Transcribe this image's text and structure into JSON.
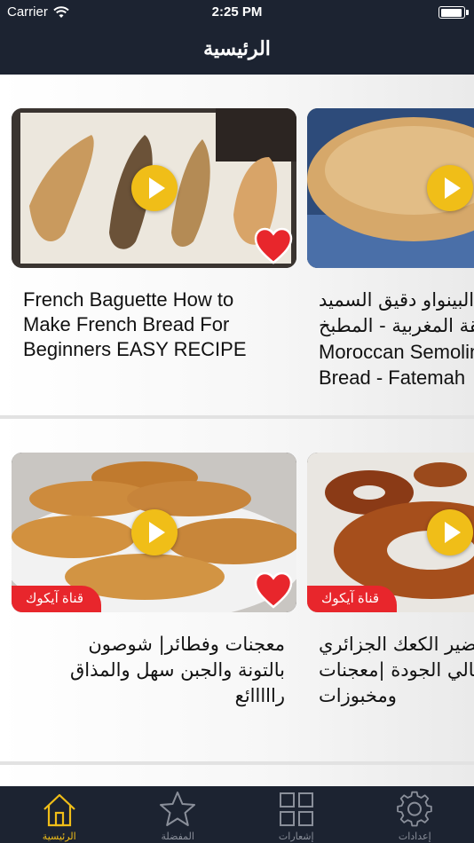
{
  "status_bar": {
    "carrier": "Carrier",
    "time": "2:25 PM",
    "battery_level": 0.95
  },
  "nav": {
    "title": "الرئيسية"
  },
  "rows": [
    {
      "cards": [
        {
          "title_lines": [
            "French Baguette How to",
            "Make French Bread For",
            "Beginners EASY RECIPE"
          ],
          "favorite": true,
          "badge": ""
        },
        {
          "title_lines": [
            "طريقة خبز البينواو دقيق السميد",
            "بالطريقة المغربية - المطبخ",
            "Moroccan Semolina",
            "Bread - Fatemah"
          ],
          "favorite": false,
          "badge": ""
        }
      ]
    },
    {
      "cards": [
        {
          "title_lines": [
            "معجنات وفطائر| شوصون",
            "بالتونة والجبن سهل والمذاق",
            "رااااائع"
          ],
          "favorite": true,
          "badge": "قناة آيكوك"
        },
        {
          "title_lines": [
            "طريقة تحضير الكعك الجزائري",
            "عالي الجودة |معجنات",
            "ومخبوزات"
          ],
          "favorite": false,
          "badge": "قناة آيكوك"
        }
      ]
    }
  ],
  "tabs": [
    {
      "label": "الرئيسية",
      "icon": "home-icon",
      "active": true
    },
    {
      "label": "المفضلة",
      "icon": "star-icon",
      "active": false
    },
    {
      "label": "إشعارات",
      "icon": "grid-icon",
      "active": false
    },
    {
      "label": "إعدادات",
      "icon": "gear-icon",
      "active": false
    }
  ],
  "colors": {
    "bar": "#1c2331",
    "accent": "#f0be18",
    "badge": "#e8262c",
    "heart": "#e8262c"
  }
}
